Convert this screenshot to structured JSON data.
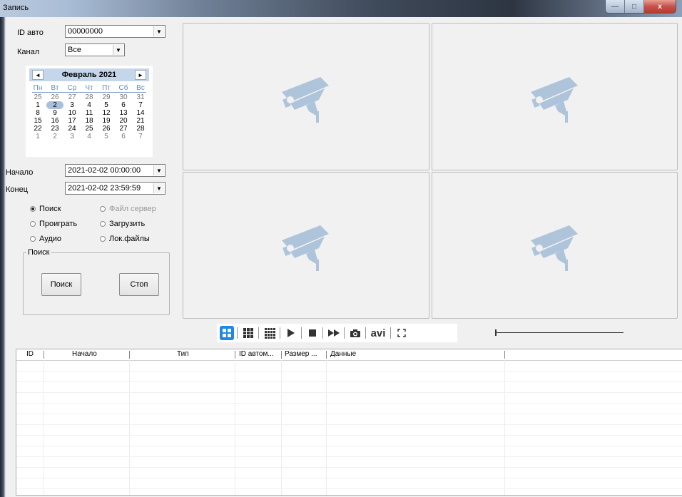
{
  "window": {
    "title": "Запись",
    "min": "—",
    "max": "□",
    "close": "x"
  },
  "left": {
    "id_label": "ID авто",
    "id_value": "00000000",
    "channel_label": "Канал",
    "channel_value": "Все",
    "start_label": "Начало",
    "start_value": "2021-02-02 00:00:00",
    "end_label": "Конец",
    "end_value": "2021-02-02 23:59:59"
  },
  "calendar": {
    "month": "Февраль 2021",
    "prev": "◄",
    "next": "►",
    "dow": [
      "Пн",
      "Вт",
      "Ср",
      "Чт",
      "Пт",
      "Сб",
      "Вс"
    ],
    "weeks": [
      [
        "25",
        "26",
        "27",
        "28",
        "29",
        "30",
        "31"
      ],
      [
        "1",
        "2",
        "3",
        "4",
        "5",
        "6",
        "7"
      ],
      [
        "8",
        "9",
        "10",
        "11",
        "12",
        "13",
        "14"
      ],
      [
        "15",
        "16",
        "17",
        "18",
        "19",
        "20",
        "21"
      ],
      [
        "22",
        "23",
        "24",
        "25",
        "26",
        "27",
        "28"
      ],
      [
        "1",
        "2",
        "3",
        "4",
        "5",
        "6",
        "7"
      ]
    ]
  },
  "modes": {
    "search": "Поиск",
    "play": "Проиграть",
    "audio": "Аудио",
    "server": "Файл сервер",
    "download": "Загрузить",
    "local": "Лок.файлы"
  },
  "group": {
    "title": "Поиск",
    "search_button": "Поиск",
    "stop_button": "Стоп"
  },
  "toolbar": {
    "avi": "avi"
  },
  "table": {
    "headers": [
      "ID",
      "Начало",
      "Тип",
      "ID автом...",
      "Размер ...",
      "Данные"
    ]
  }
}
